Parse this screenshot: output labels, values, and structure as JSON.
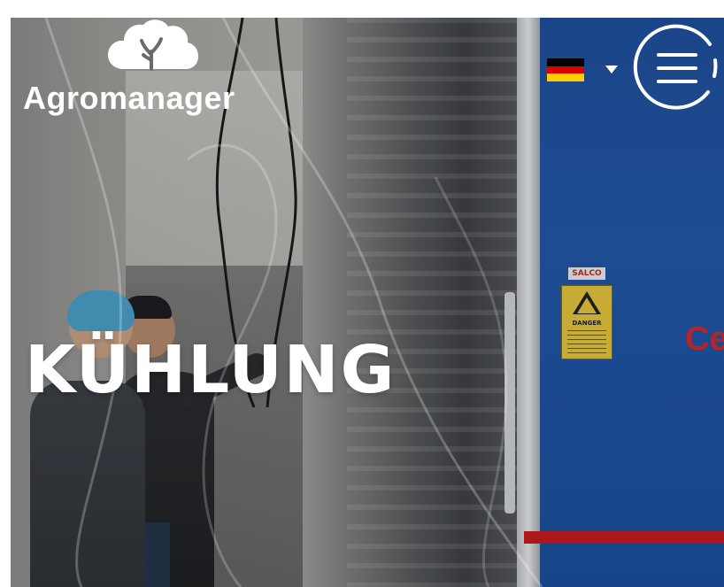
{
  "header": {
    "logo_text": "Agromanager",
    "logo_icon": "cloud-tree-icon",
    "language": {
      "icon": "german-flag-icon",
      "colors": [
        "#000000",
        "#dd0000",
        "#ffce00"
      ],
      "caret_icon": "caret-down-icon"
    },
    "menu": {
      "icon": "hamburger-icon"
    }
  },
  "hero": {
    "title": "KÜHLUNG",
    "sign_brand": "SALCO",
    "sign_label": "DANGER",
    "door_text": "Ce"
  },
  "colors": {
    "door_blue": "#2157a8",
    "accent_red": "#c41b1f",
    "text_white": "#ffffff"
  }
}
